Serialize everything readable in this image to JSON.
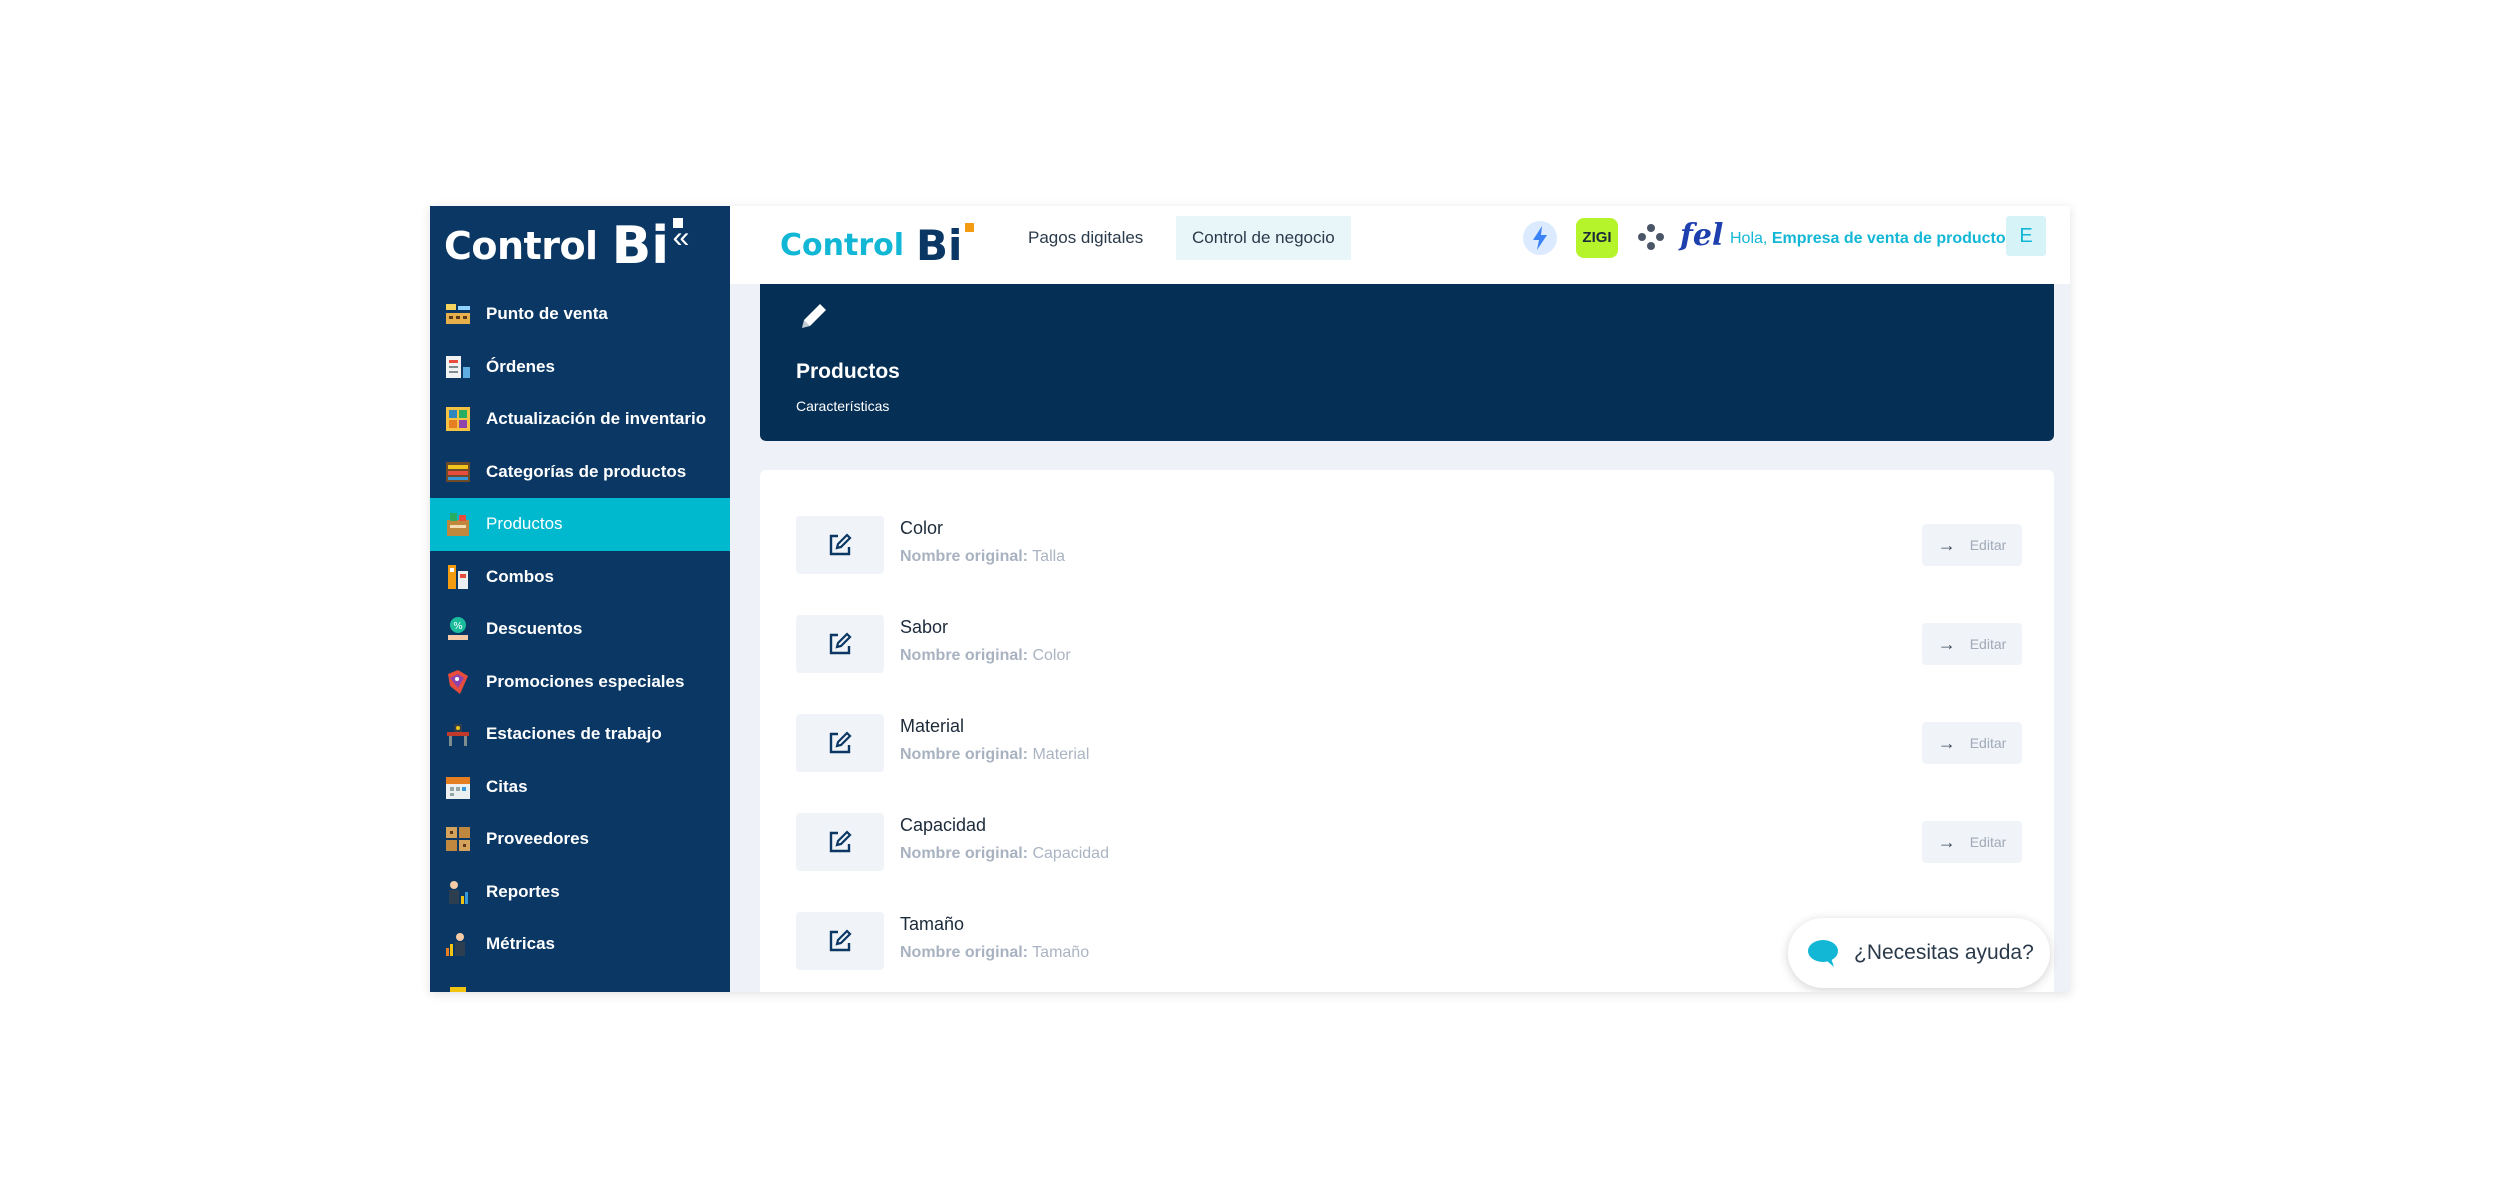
{
  "sidebar": {
    "logo": {
      "text": "Control",
      "mark": "Bi"
    },
    "collapse_icon": "«",
    "items": [
      {
        "label": "Punto de venta",
        "icon": "cash-register-icon",
        "active": false
      },
      {
        "label": "Órdenes",
        "icon": "orders-icon",
        "active": false
      },
      {
        "label": "Actualización de inventario",
        "icon": "inventory-icon",
        "active": false
      },
      {
        "label": "Categorías de productos",
        "icon": "categories-icon",
        "active": false
      },
      {
        "label": "Productos",
        "icon": "products-icon",
        "active": true
      },
      {
        "label": "Combos",
        "icon": "combos-icon",
        "active": false
      },
      {
        "label": "Descuentos",
        "icon": "discounts-icon",
        "active": false
      },
      {
        "label": "Promociones especiales",
        "icon": "promotions-icon",
        "active": false
      },
      {
        "label": "Estaciones de trabajo",
        "icon": "workstations-icon",
        "active": false
      },
      {
        "label": "Citas",
        "icon": "calendar-icon",
        "active": false
      },
      {
        "label": "Proveedores",
        "icon": "suppliers-icon",
        "active": false
      },
      {
        "label": "Reportes",
        "icon": "reports-icon",
        "active": false
      },
      {
        "label": "Métricas",
        "icon": "metrics-icon",
        "active": false
      }
    ]
  },
  "header": {
    "logo": {
      "text": "Control",
      "mark": "Bi"
    },
    "nav": [
      {
        "label": "Pagos digitales"
      },
      {
        "label": "Control de negocio"
      }
    ],
    "zigi_label": "ZIGI",
    "fel_label": "fel",
    "greeting_prefix": "Hola,",
    "company_name": "Empresa de venta de productos",
    "avatar_initial": "E"
  },
  "banner": {
    "title": "Productos",
    "subtitle": "Características"
  },
  "features": {
    "original_label": "Nombre original:",
    "edit_label": "Editar",
    "edit_arrow": "→",
    "rows": [
      {
        "name": "Color",
        "original": "Talla"
      },
      {
        "name": "Sabor",
        "original": "Color"
      },
      {
        "name": "Material",
        "original": "Material"
      },
      {
        "name": "Capacidad",
        "original": "Capacidad"
      },
      {
        "name": "Tamaño",
        "original": "Tamaño"
      }
    ]
  },
  "help": {
    "label": "¿Necesitas ayuda?"
  },
  "colors": {
    "sidebar_bg": "#0a3763",
    "active_item": "#00b9cf",
    "brand_cyan": "#12b7d6",
    "banner_bg": "#062f55",
    "zigi_green": "#b5f32a"
  }
}
